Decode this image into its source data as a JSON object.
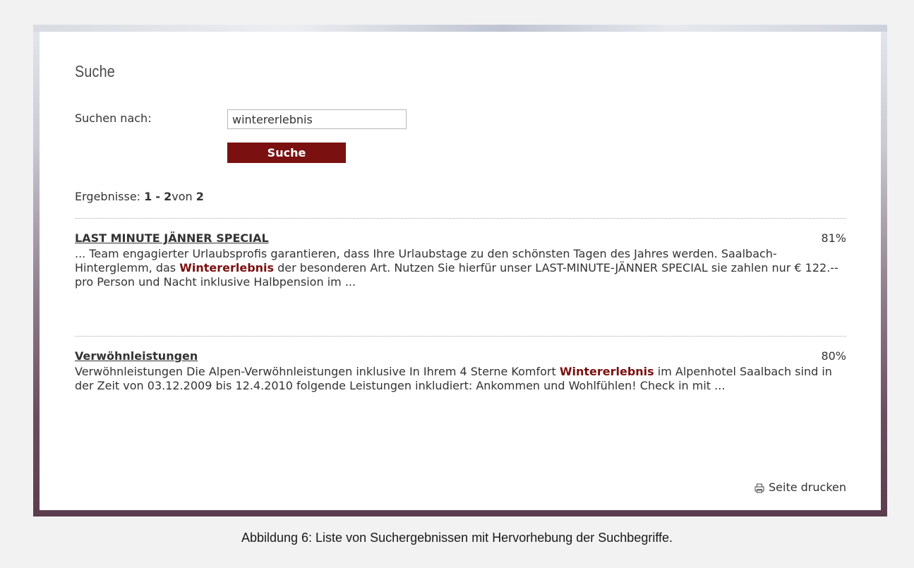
{
  "page": {
    "title": "Suche"
  },
  "search": {
    "label": "Suchen nach:",
    "value": "wintererlebnis",
    "button_label": "Suche"
  },
  "results_count": {
    "prefix": "Ergebnisse:",
    "from": "1",
    "dash": "-",
    "to": "2",
    "of_word": "von",
    "total": "2"
  },
  "results": [
    {
      "title": "LAST MINUTE JÄNNER SPECIAL",
      "score": "81%",
      "snippet_before": "... Team engagierter Urlaubsprofis garantieren, dass Ihre Urlaubstage zu den schönsten Tagen des Jahres werden. Saalbach-Hinterglemm, das ",
      "snippet_highlight": "Wintererlebnis",
      "snippet_after": " der besonderen Art. Nutzen Sie hierfür unser LAST-MINUTE-JÄNNER SPECIAL sie zahlen nur € 122.-- pro Person und Nacht inklusive Halbpension im ..."
    },
    {
      "title": "Verwöhnleistungen",
      "score": "80%",
      "snippet_before": "Verwöhnleistungen Die Alpen-Verwöhnleistungen inklusive In Ihrem 4 Sterne Komfort  ",
      "snippet_highlight": "Wintererlebnis",
      "snippet_after": " im Alpenhotel Saalbach sind in der Zeit von 03.12.2009 bis 12.4.2010 folgende Leistungen inkludiert: Ankommen und Wohlfühlen! Check in mit ..."
    }
  ],
  "footer": {
    "print_label": "Seite drucken",
    "print_icon": "printer-icon"
  },
  "caption": "Abbildung 6: Liste von Suchergebnissen mit Hervorhebung der Suchbegriffe.",
  "colors": {
    "accent": "#7a1010",
    "text": "#333333"
  }
}
